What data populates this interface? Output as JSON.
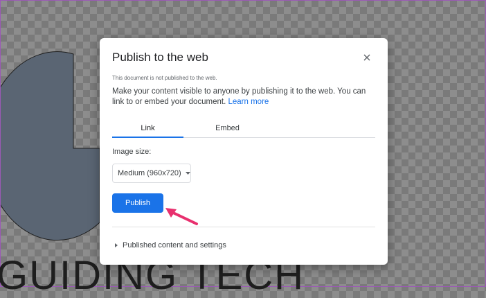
{
  "background": {
    "watermark_text": "GUIDING TECH"
  },
  "dialog": {
    "title": "Publish to the web",
    "close_icon": "close-icon",
    "status": "This document is not published to the web.",
    "description": "Make your content visible to anyone by publishing it to the web. You can link to or embed your document.",
    "learn_more": "Learn more",
    "tabs": [
      {
        "label": "Link",
        "active": true
      },
      {
        "label": "Embed",
        "active": false
      }
    ],
    "image_size_label": "Image size:",
    "image_size_value": "Medium (960x720)",
    "publish_label": "Publish",
    "section_label": "Published content and settings"
  },
  "colors": {
    "accent": "#1a73e8",
    "annotation_arrow": "#e8306e"
  }
}
